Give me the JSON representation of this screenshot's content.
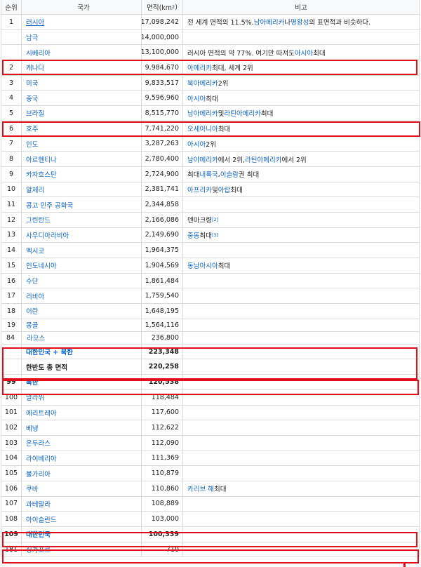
{
  "headers": {
    "rank": "순위",
    "country": "국가",
    "area": "면적(km",
    "area_sup": "2",
    "area_close": ")",
    "note": "비고"
  },
  "rows": [
    {
      "rank": "1",
      "country": "러시아",
      "underline": true,
      "area": "17,098,242",
      "note": [
        {
          "t": "전 세계 면적의 11.5%. "
        },
        {
          "t": "남아메리카",
          "link": true
        },
        {
          "t": "나 "
        },
        {
          "t": "명왕성",
          "link": true
        },
        {
          "t": "의 표면적과 비슷하다."
        }
      ]
    },
    {
      "rank": "",
      "country": "남극",
      "area": "14,000,000",
      "note": []
    },
    {
      "rank": "",
      "country": "시베리아",
      "area": "13,100,000",
      "note": [
        {
          "t": "러시아 면적의 약 77%. 여기만 따져도 "
        },
        {
          "t": "아시아",
          "link": true
        },
        {
          "t": " 최대"
        }
      ]
    },
    {
      "rank": "2",
      "country": "캐나다",
      "area": "9,984,670",
      "note": [
        {
          "t": "아메리카",
          "link": true
        },
        {
          "t": " 최대, 세계 2위"
        }
      ]
    },
    {
      "rank": "3",
      "country": "미국",
      "area": "9,833,517",
      "note": [
        {
          "t": "북아메리카",
          "link": true
        },
        {
          "t": " 2위"
        }
      ]
    },
    {
      "rank": "4",
      "country": "중국",
      "area": "9,596,960",
      "note": [
        {
          "t": "아시아",
          "link": true
        },
        {
          "t": " 최대"
        }
      ]
    },
    {
      "rank": "5",
      "country": "브라질",
      "area": "8,515,770",
      "note": [
        {
          "t": "남아메리카",
          "link": true
        },
        {
          "t": " 및 "
        },
        {
          "t": "라틴아메리카",
          "link": true
        },
        {
          "t": " 최대"
        }
      ]
    },
    {
      "rank": "6",
      "country": "호주",
      "area": "7,741,220",
      "note": [
        {
          "t": "오세아니아",
          "link": true
        },
        {
          "t": " 최대"
        }
      ]
    },
    {
      "rank": "7",
      "country": "인도",
      "area": "3,287,263",
      "note": [
        {
          "t": "아시아",
          "link": true
        },
        {
          "t": " 2위"
        }
      ]
    },
    {
      "rank": "8",
      "country": "아르헨티나",
      "area": "2,780,400",
      "note": [
        {
          "t": "남아메리카",
          "link": true
        },
        {
          "t": "에서 2위, "
        },
        {
          "t": "라틴아메리카",
          "link": true
        },
        {
          "t": "에서 2위"
        }
      ]
    },
    {
      "rank": "9",
      "country": "카자흐스탄",
      "area": "2,724,900",
      "note": [
        {
          "t": "최대 "
        },
        {
          "t": "내륙국",
          "link": true
        },
        {
          "t": ", "
        },
        {
          "t": "이슬람",
          "link": true
        },
        {
          "t": "권 최대"
        }
      ]
    },
    {
      "rank": "10",
      "country": "알제리",
      "area": "2,381,741",
      "note": [
        {
          "t": "아프리카",
          "link": true
        },
        {
          "t": " 및 "
        },
        {
          "t": "아랍",
          "link": true
        },
        {
          "t": " 최대"
        }
      ]
    },
    {
      "rank": "11",
      "country": "콩고 민주 공화국",
      "area": "2,344,858",
      "note": []
    },
    {
      "rank": "12",
      "country": "그린란드",
      "area": "2,166,086",
      "note": [
        {
          "t": "덴마크령"
        },
        {
          "t": "[2]",
          "sup": true
        }
      ]
    },
    {
      "rank": "13",
      "country": "사우디아라비아",
      "area": "2,149,690",
      "note": [
        {
          "t": "중동",
          "link": true
        },
        {
          "t": " 최대"
        },
        {
          "t": "[3]",
          "sup": true
        }
      ]
    },
    {
      "rank": "14",
      "country": "멕시코",
      "area": "1,964,375",
      "note": []
    },
    {
      "rank": "15",
      "country": "인도네시아",
      "area": "1,904,569",
      "note": [
        {
          "t": "동남아시아",
          "link": true
        },
        {
          "t": " 최대"
        }
      ]
    },
    {
      "rank": "16",
      "country": "수단",
      "area": "1,861,484",
      "note": []
    },
    {
      "rank": "17",
      "country": "리비아",
      "area": "1,759,540",
      "note": []
    },
    {
      "rank": "18",
      "country": "이란",
      "area": "1,648,195",
      "note": []
    },
    {
      "rank": "19",
      "country": "몽골",
      "area": "1,564,116",
      "note": [],
      "style": "short"
    },
    {
      "rank": "84",
      "country": "라오스",
      "area": "236,800",
      "note": [],
      "style": "compact dim"
    },
    {
      "rank": "",
      "country": "대한민국 + 북한",
      "area": "223,348",
      "note": [],
      "style": "bold"
    },
    {
      "rank": "",
      "country": "한반도 총 면적",
      "area": "220,258",
      "note": [],
      "style": "bold plain"
    },
    {
      "rank": "99",
      "country": "북한",
      "area": "120,538",
      "note": [],
      "style": "bold"
    },
    {
      "rank": "100",
      "country": "말라위",
      "area": "118,484",
      "note": []
    },
    {
      "rank": "101",
      "country": "에리트레아",
      "area": "117,600",
      "note": []
    },
    {
      "rank": "102",
      "country": "베냉",
      "area": "112,622",
      "note": []
    },
    {
      "rank": "103",
      "country": "온두라스",
      "area": "112,090",
      "note": []
    },
    {
      "rank": "104",
      "country": "라이베리아",
      "area": "111,369",
      "note": []
    },
    {
      "rank": "105",
      "country": "불가리아",
      "area": "110,879",
      "note": []
    },
    {
      "rank": "106",
      "country": "쿠바",
      "area": "110,860",
      "note": [
        {
          "t": "카리브 해",
          "link": true
        },
        {
          "t": " 최대"
        }
      ]
    },
    {
      "rank": "107",
      "country": "과테말라",
      "area": "108,889",
      "note": []
    },
    {
      "rank": "108",
      "country": "아이슬란드",
      "area": "103,000",
      "note": []
    },
    {
      "rank": "109",
      "country": "대한민국",
      "area": "100,339",
      "note": [],
      "style": "bold"
    },
    {
      "rank": "181",
      "country": "싱가포르",
      "area": "710",
      "note": []
    }
  ],
  "highlight_color": "#e0101b",
  "link_color": "#0b63c5"
}
